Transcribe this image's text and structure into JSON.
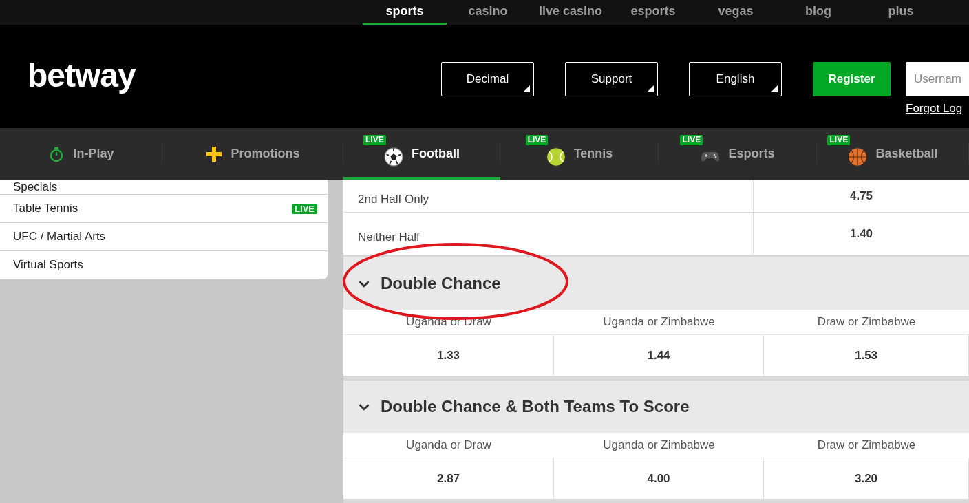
{
  "top_links": [
    {
      "label": "sports",
      "selected": true
    },
    {
      "label": "casino",
      "selected": false
    },
    {
      "label": "live casino",
      "selected": false
    },
    {
      "label": "esports",
      "selected": false
    },
    {
      "label": "vegas",
      "selected": false
    },
    {
      "label": "blog",
      "selected": false
    },
    {
      "label": "plus",
      "selected": false
    }
  ],
  "header": {
    "logo": "betway",
    "dropdowns": [
      "Decimal",
      "Support",
      "English"
    ],
    "register": "Register",
    "username": {
      "placeholder": "Usernam"
    },
    "forgot_link": "Forgot Log"
  },
  "sport_nav": [
    {
      "label": "In-Play",
      "selected": false
    },
    {
      "label": "Promotions",
      "selected": false
    },
    {
      "label": "Football",
      "badge": "LIVE",
      "selected": true
    },
    {
      "label": "Tennis",
      "badge": "LIVE",
      "selected": false
    },
    {
      "label": "Esports",
      "badge": "LIVE",
      "selected": false
    },
    {
      "label": "Basketball",
      "badge": "LIVE",
      "selected": false
    }
  ],
  "sidebar": {
    "items": [
      {
        "label": "Specials"
      },
      {
        "label": "Table Tennis",
        "badge": "LIVE"
      },
      {
        "label": "UFC / Martial Arts"
      },
      {
        "label": "Virtual Sports"
      }
    ]
  },
  "outcome_rows": [
    {
      "label": "2nd Half Only",
      "odds": "4.75"
    },
    {
      "label": "Neither Half",
      "odds": "1.40"
    }
  ],
  "markets": [
    {
      "title": "Double Chance",
      "highlighted": true,
      "selections": [
        {
          "label": "Uganda or Draw",
          "odds": "1.33"
        },
        {
          "label": "Uganda or Zimbabwe",
          "odds": "1.44"
        },
        {
          "label": "Draw or Zimbabwe",
          "odds": "1.53"
        }
      ]
    },
    {
      "title": "Double Chance & Both Teams To Score",
      "highlighted": false,
      "selections": [
        {
          "label": "Uganda or Draw",
          "odds": "2.87"
        },
        {
          "label": "Uganda or Zimbabwe",
          "odds": "4.00"
        },
        {
          "label": "Draw or Zimbabwe",
          "odds": "3.20"
        }
      ]
    }
  ]
}
